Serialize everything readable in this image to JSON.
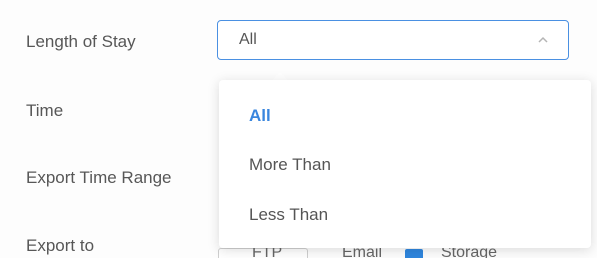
{
  "form": {
    "labels": {
      "length_of_stay": "Length of Stay",
      "time": "Time",
      "export_time_range": "Export Time Range",
      "export_to": "Export to"
    },
    "length_of_stay_select": {
      "value": "All",
      "expanded": true,
      "accent_color": "#4a90e2"
    }
  },
  "dropdown": {
    "options": [
      {
        "label": "All",
        "selected": true
      },
      {
        "label": "More Than",
        "selected": false
      },
      {
        "label": "Less Than",
        "selected": false
      }
    ],
    "selected_color": "#3a86de"
  },
  "export_to_partial": {
    "option_1": "FTP",
    "option_2": "Email",
    "option_3": "Storage",
    "storage_checked": true,
    "checkbox_color": "#2f86de"
  },
  "icons": {
    "select_chevron": "chevron-up-icon",
    "storage_checkbox": "checkbox-checked-icon"
  }
}
